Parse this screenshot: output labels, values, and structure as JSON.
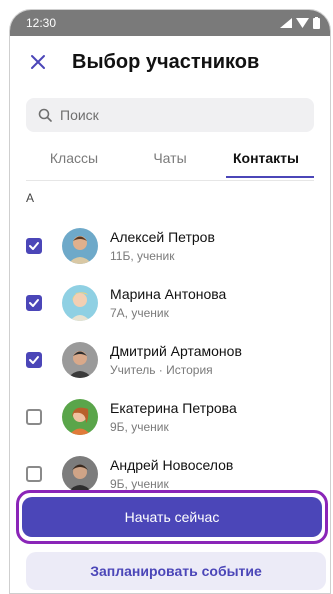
{
  "status_bar": {
    "time": "12:30"
  },
  "header": {
    "title": "Выбор участников"
  },
  "search": {
    "placeholder": "Поиск"
  },
  "tabs": [
    {
      "label": "Классы",
      "active": false
    },
    {
      "label": "Чаты",
      "active": false
    },
    {
      "label": "Контакты",
      "active": true
    }
  ],
  "section_letter": "А",
  "contacts": [
    {
      "name": "Алексей Петров",
      "subtitle": "11Б, ученик",
      "checked": true
    },
    {
      "name": "Марина Антонова",
      "subtitle": "7А, ученик",
      "checked": true
    },
    {
      "name": "Дмитрий Артамонов",
      "subtitle": "Учитель · История",
      "checked": true
    },
    {
      "name": "Екатерина Петрова",
      "subtitle": "9Б, ученик",
      "checked": false
    },
    {
      "name": "Андрей Новоселов",
      "subtitle": "9Б, ученик",
      "checked": false
    }
  ],
  "buttons": {
    "start_now": "Начать сейчас",
    "schedule": "Запланировать событие"
  },
  "colors": {
    "accent": "#4b46b8",
    "highlight_outline": "#8a25b8",
    "secondary_bg": "#ecebf7"
  }
}
